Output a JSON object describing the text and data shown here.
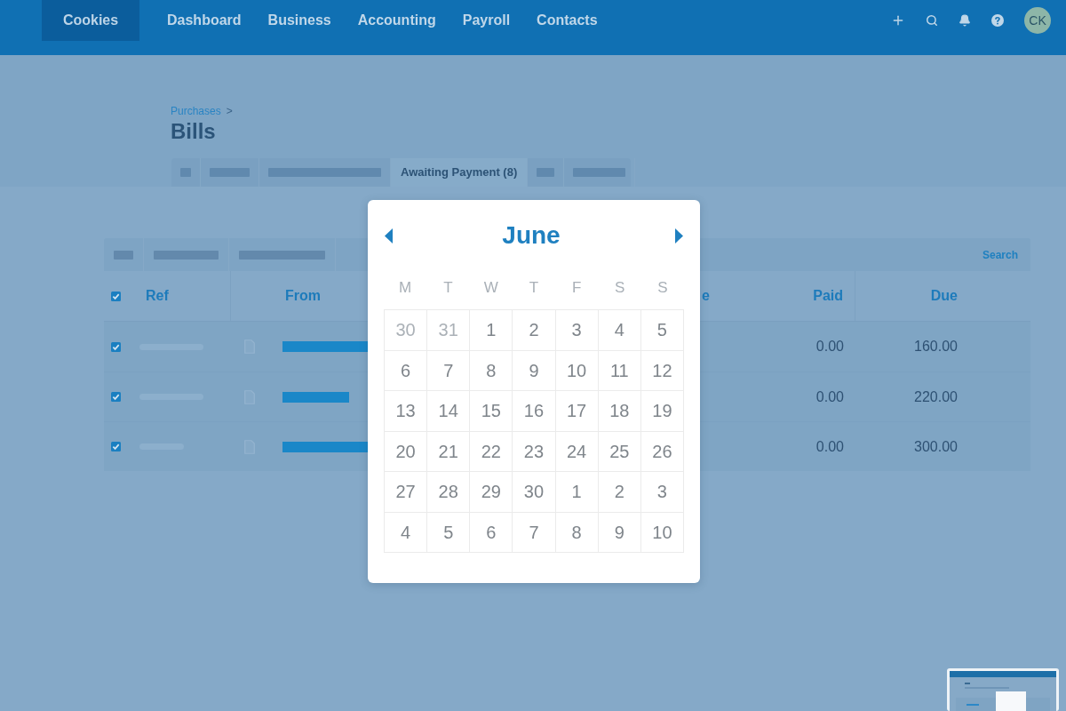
{
  "top_nav": {
    "organization": "Cookies",
    "items": [
      {
        "label": "Dashboard"
      },
      {
        "label": "Business"
      },
      {
        "label": "Accounting"
      },
      {
        "label": "Payroll"
      },
      {
        "label": "Contacts"
      }
    ],
    "actions": [
      {
        "kind": "add"
      },
      {
        "kind": "search"
      },
      {
        "kind": "notifications"
      },
      {
        "kind": "help"
      }
    ],
    "avatar": "CK"
  },
  "breadcrumb": {
    "link": "Purchases",
    "separator": ">"
  },
  "title": "Bills",
  "tabs": [
    {
      "kind": "blurred",
      "selected": false
    },
    {
      "kind": "blurred",
      "selected": false
    },
    {
      "kind": "blurred",
      "selected": false
    },
    {
      "kind": "text",
      "label": "Awaiting Payment (8)",
      "selected": true
    },
    {
      "kind": "blurred",
      "selected": false
    },
    {
      "kind": "blurred",
      "selected": false
    }
  ],
  "bills_table": {
    "toolbar": [
      {
        "kind": "blurred"
      },
      {
        "kind": "blurred"
      },
      {
        "kind": "blurred"
      },
      {
        "kind": "link",
        "label": "Search"
      }
    ],
    "header": {
      "checked": true,
      "columns": [
        {
          "label": "Ref"
        },
        {
          "label": "From"
        },
        {
          "label": "e"
        },
        {
          "label": "Paid"
        },
        {
          "label": "Due"
        }
      ]
    },
    "rows": [
      {
        "checked": true,
        "paid": "0.00",
        "due": "160.00"
      },
      {
        "checked": true,
        "paid": "0.00",
        "due": "220.00"
      },
      {
        "checked": true,
        "paid": "0.00",
        "due": "300.00"
      }
    ]
  },
  "date_picker": {
    "month": "June",
    "weekdays": [
      "M",
      "T",
      "W",
      "T",
      "F",
      "S",
      "S"
    ],
    "days": [
      {
        "label": "30",
        "muted": true
      },
      {
        "label": "31",
        "muted": true
      },
      {
        "label": "1",
        "muted": false
      },
      {
        "label": "2",
        "muted": false
      },
      {
        "label": "3",
        "muted": false
      },
      {
        "label": "4",
        "muted": false
      },
      {
        "label": "5",
        "muted": false
      },
      {
        "label": "6",
        "muted": false
      },
      {
        "label": "7",
        "muted": false
      },
      {
        "label": "8",
        "muted": false
      },
      {
        "label": "9",
        "muted": false
      },
      {
        "label": "10",
        "muted": false
      },
      {
        "label": "11",
        "muted": false
      },
      {
        "label": "12",
        "muted": false
      },
      {
        "label": "13",
        "muted": false
      },
      {
        "label": "14",
        "muted": false
      },
      {
        "label": "15",
        "muted": false
      },
      {
        "label": "16",
        "muted": false
      },
      {
        "label": "17",
        "muted": false
      },
      {
        "label": "18",
        "muted": false
      },
      {
        "label": "19",
        "muted": false
      },
      {
        "label": "20",
        "muted": false
      },
      {
        "label": "21",
        "muted": false
      },
      {
        "label": "22",
        "muted": false
      },
      {
        "label": "23",
        "muted": false
      },
      {
        "label": "24",
        "muted": false
      },
      {
        "label": "25",
        "muted": false
      },
      {
        "label": "26",
        "muted": false
      },
      {
        "label": "27",
        "muted": false
      },
      {
        "label": "28",
        "muted": false
      },
      {
        "label": "29",
        "muted": false
      },
      {
        "label": "30",
        "muted": false
      },
      {
        "label": "1",
        "muted": false
      },
      {
        "label": "2",
        "muted": false
      },
      {
        "label": "3",
        "muted": false
      },
      {
        "label": "4",
        "muted": false
      },
      {
        "label": "5",
        "muted": false
      },
      {
        "label": "6",
        "muted": false
      },
      {
        "label": "7",
        "muted": false
      },
      {
        "label": "8",
        "muted": false
      },
      {
        "label": "9",
        "muted": false
      },
      {
        "label": "10",
        "muted": false
      }
    ]
  }
}
